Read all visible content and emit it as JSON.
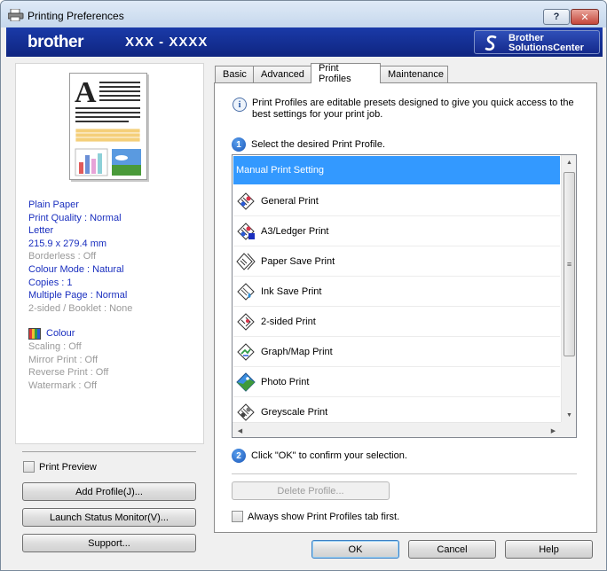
{
  "window": {
    "title": "Printing Preferences",
    "help_label": "?",
    "close_label": "✕"
  },
  "banner": {
    "brand": "brother",
    "model": "XXX - XXXX",
    "solutions_line1": "Brother",
    "solutions_line2": "SolutionsCenter"
  },
  "summary": {
    "items": [
      {
        "text": "Plain Paper",
        "state": "active"
      },
      {
        "text": "Print Quality : Normal",
        "state": "active"
      },
      {
        "text": "Letter",
        "state": "active"
      },
      {
        "text": "215.9 x 279.4 mm",
        "state": "active"
      },
      {
        "text": "Borderless : Off",
        "state": "inactive"
      },
      {
        "text": "Colour Mode : Natural",
        "state": "active"
      },
      {
        "text": "Copies : 1",
        "state": "active"
      },
      {
        "text": "Multiple Page : Normal",
        "state": "active"
      },
      {
        "text": "2-sided / Booklet : None",
        "state": "inactive"
      }
    ],
    "colour_label": "Colour",
    "sub_items": [
      "Scaling : Off",
      "Mirror Print : Off",
      "Reverse Print : Off",
      "Watermark : Off"
    ]
  },
  "left_controls": {
    "print_preview": "Print Preview",
    "add_profile": "Add Profile(J)...",
    "status_monitor": "Launch Status Monitor(V)...",
    "support": "Support..."
  },
  "tabs": [
    {
      "label": "Basic",
      "active": false
    },
    {
      "label": "Advanced",
      "active": false
    },
    {
      "label": "Print Profiles",
      "active": true
    },
    {
      "label": "Maintenance",
      "active": false
    }
  ],
  "profiles_tab": {
    "intro": "Print Profiles are editable presets designed to give you quick access to the best settings for your print job.",
    "step1_num": "1",
    "step1_text": "Select the desired Print Profile.",
    "profiles": [
      {
        "label": "Manual Print Setting",
        "icon": "none",
        "selected": true
      },
      {
        "label": "General Print",
        "icon": "general-print-icon",
        "selected": false
      },
      {
        "label": "A3/Ledger Print",
        "icon": "a3-print-icon",
        "selected": false
      },
      {
        "label": "Paper Save Print",
        "icon": "paper-save-icon",
        "selected": false
      },
      {
        "label": "Ink Save Print",
        "icon": "ink-save-icon",
        "selected": false
      },
      {
        "label": "2-sided Print",
        "icon": "two-sided-icon",
        "selected": false
      },
      {
        "label": "Graph/Map Print",
        "icon": "graph-map-icon",
        "selected": false
      },
      {
        "label": "Photo Print",
        "icon": "photo-print-icon",
        "selected": false
      },
      {
        "label": "Greyscale Print",
        "icon": "greyscale-icon",
        "selected": false
      }
    ],
    "step2_num": "2",
    "step2_text": "Click \"OK\" to confirm your selection.",
    "delete_profile": "Delete Profile...",
    "always_show": "Always show Print Profiles tab first."
  },
  "footer": {
    "ok": "OK",
    "cancel": "Cancel",
    "help": "Help"
  },
  "colors": {
    "banner": "#14298c",
    "selection": "#3399ff",
    "summary_blue": "#1a2fbf",
    "summary_grey": "#9a9a9a"
  }
}
